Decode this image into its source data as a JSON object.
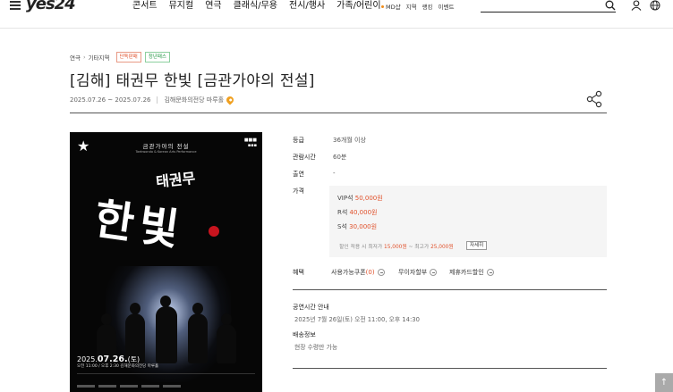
{
  "header": {
    "logo": "yes24",
    "nav": [
      "콘서트",
      "뮤지컬",
      "연극",
      "클래식/무용",
      "전시/행사",
      "가족/어린이"
    ],
    "subnav": [
      "MD샵",
      "지역",
      "랭킹",
      "이벤트"
    ]
  },
  "breadcrumb": {
    "category": "연극",
    "sub": "기타지역",
    "badges": [
      "단독판매",
      "청년패스"
    ]
  },
  "event": {
    "title": "[김해] 태권무 한빛 [금관가야의 전설]",
    "dates": "2025.07.26 ~ 2025.07.26",
    "venue": "김해문화의전당 마루홀"
  },
  "poster": {
    "top_title": "금관가야의 전설",
    "subtitle": "Taekwondo & Korean Arts Performance",
    "name": "태권무",
    "big": "한빛",
    "date_prefix": "2025.",
    "date_bold": "07.26.",
    "date_suffix": "(토)",
    "time": "오전 11:00 / 오후 2:30  김해문화의전당 마루홀"
  },
  "info": {
    "grade_label": "등급",
    "grade": "36개월 이상",
    "runtime_label": "관람시간",
    "runtime": "60분",
    "cast_label": "출연",
    "cast": "-",
    "price_label": "가격",
    "prices": [
      {
        "seat": "VIP석",
        "amount": "50,000원"
      },
      {
        "seat": "R석",
        "amount": "40,000원"
      },
      {
        "seat": "S석",
        "amount": "30,000원"
      }
    ],
    "discount_prefix": "할인 적용 시 최저가 ",
    "discount_low": "15,000원",
    "discount_mid": " ~ 최고가 ",
    "discount_high": "25,000원",
    "detail_btn": "자세히",
    "benefit_label": "혜택",
    "benefits": {
      "coupon": "사용가능쿠폰",
      "coupon_count": "(0)",
      "installment": "무이자할부",
      "card": "제휴카드할인"
    },
    "showtime_title": "공연시간 안내",
    "showtime": "2025년 7월 26일(토) 오전 11:00, 오후 14:30",
    "delivery_title": "배송정보",
    "delivery": "현장 수령만 가능"
  },
  "top_button": "↑"
}
